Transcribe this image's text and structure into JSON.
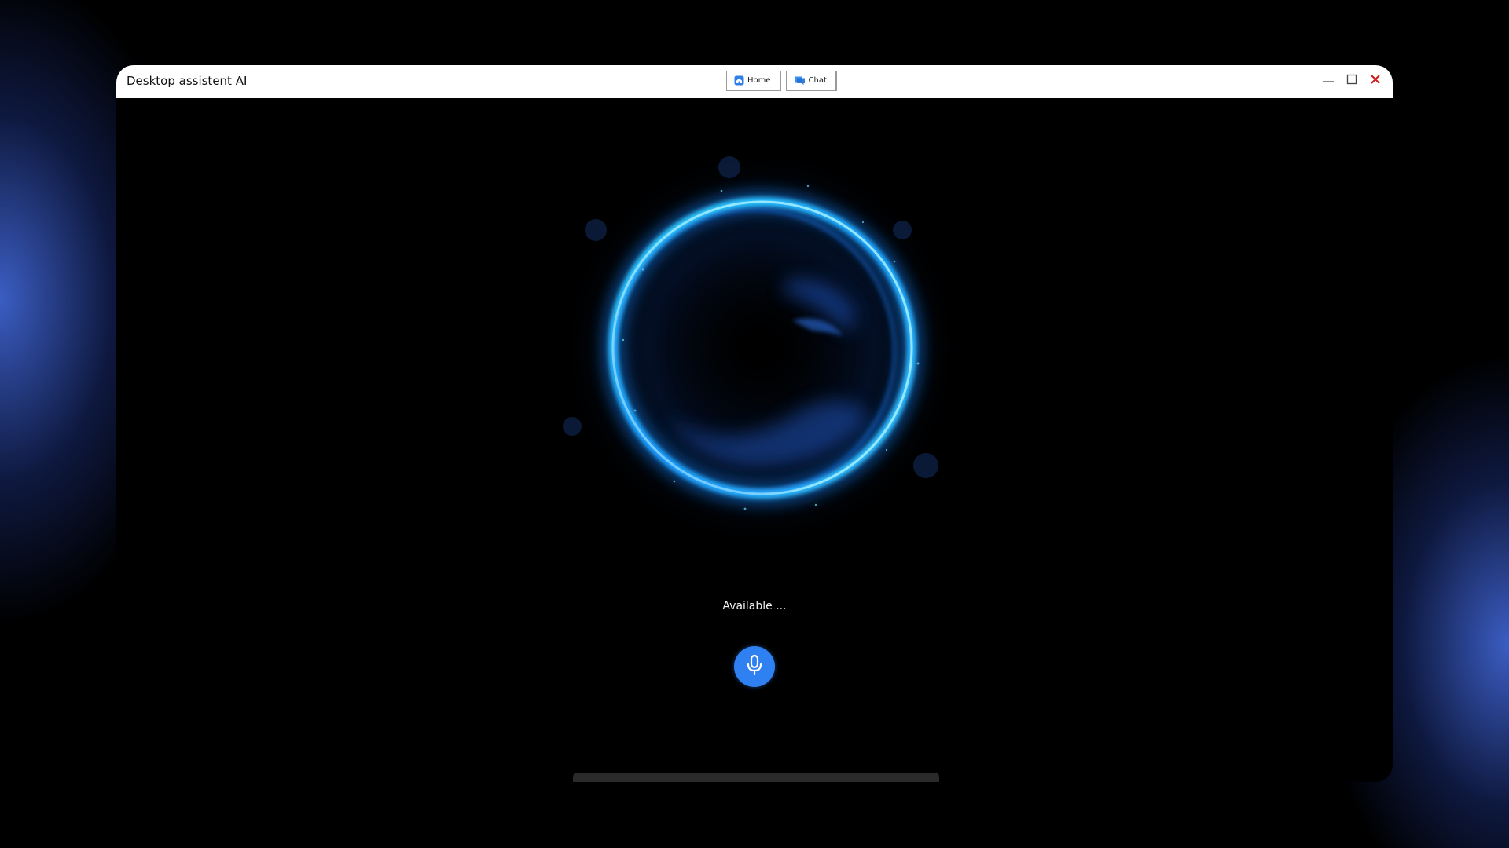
{
  "window": {
    "title": "Desktop assistent AI"
  },
  "nav": {
    "tabs": [
      {
        "label": "Home",
        "icon": "home-icon"
      },
      {
        "label": "Chat",
        "icon": "chat-icon"
      }
    ]
  },
  "controls": {
    "minimize_icon": "minimize-icon",
    "maximize_icon": "maximize-icon",
    "close_icon": "close-icon"
  },
  "main": {
    "status": "Available ...",
    "mic_icon": "microphone-icon"
  },
  "colors": {
    "accent": "#2f80f0",
    "orb_glow": "#1fb8ff",
    "close": "#d01818"
  }
}
